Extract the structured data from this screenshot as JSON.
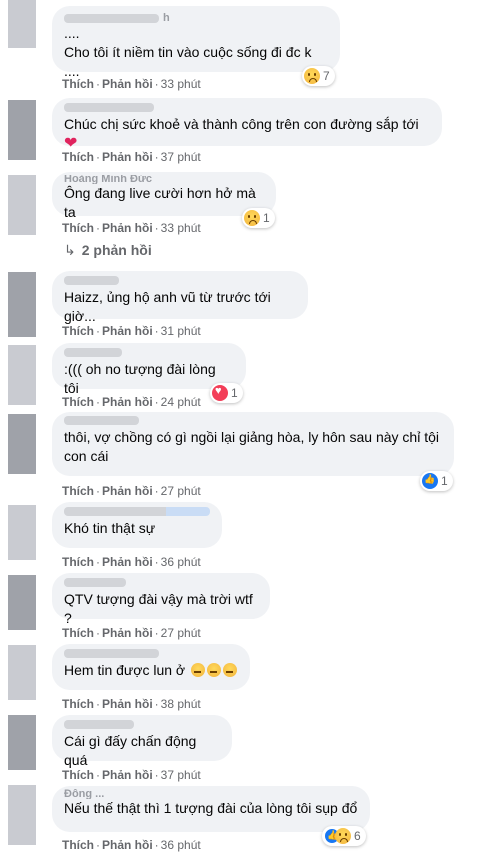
{
  "actions": {
    "like": "Thích",
    "reply": "Phản hồi"
  },
  "comments": [
    {
      "name": "h",
      "text": "....\nCho tôi ít niềm tin vào cuộc sống đi đc k ....",
      "time": "33 phút",
      "reaction": {
        "emoji": "sad",
        "count": "7"
      }
    },
    {
      "name": "",
      "text": "Chúc chị sức khoẻ và thành công trên con đường sắp tới",
      "trailing": "heart",
      "time": "37 phút"
    },
    {
      "name": "Hoàng Minh Đức",
      "text": "Ông đang live cười hơn hở mà ta",
      "time": "33 phút",
      "reaction": {
        "emoji": "sad",
        "count": "1"
      },
      "replies": "2 phản hồi"
    },
    {
      "name": "",
      "text": "Haizz, ủng hộ anh vũ từ trước tới giờ...",
      "time": "31 phút"
    },
    {
      "name": "",
      "text": ":((( oh no tượng đài lòng tôi",
      "time": "24 phút",
      "reaction": {
        "emoji": "heart",
        "count": "1"
      }
    },
    {
      "name": "",
      "text": "thôi, vợ chồng có gì ngồi lại giảng hòa, ly hôn sau này chỉ tội\ncon cái",
      "time": "27 phút",
      "reaction": {
        "emoji": "like",
        "count": "1"
      }
    },
    {
      "name": "",
      "text": "Khó tin thật sự",
      "time": "36 phút"
    },
    {
      "name": "",
      "text": "QTV tượng đài vậy mà trời wtf ?",
      "time": "27 phút"
    },
    {
      "name": "",
      "text": "Hem tin được lun ở",
      "trailing": "sad3",
      "time": "38 phút"
    },
    {
      "name": "",
      "text": "Cái gì đấy chấn động quá",
      "time": "37 phút"
    },
    {
      "name": "Đông ...",
      "text": "Nếu thế thật thì 1 tượng đài của lòng tôi sụp đổ",
      "time": "36 phút",
      "reaction": {
        "emoji": "like-sad",
        "count": "6"
      }
    }
  ],
  "colors": {
    "bubble": "#f0f2f5",
    "meta": "#65676b",
    "text": "#050505"
  }
}
